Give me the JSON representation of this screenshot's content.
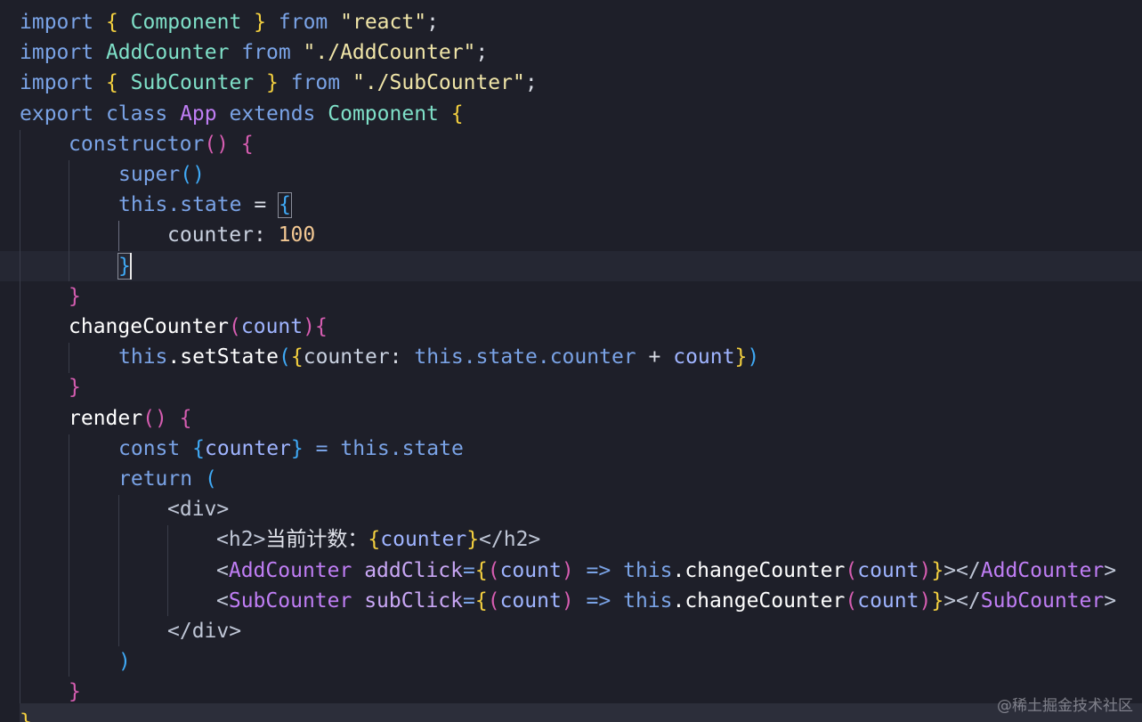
{
  "watermark": "@稀土掘金技术社区",
  "code": {
    "l1": {
      "kw": "import",
      "b1o": "{",
      "cls": "Component",
      "b1c": "}",
      "kw2": "from",
      "str": "\"react\"",
      "semi": ";"
    },
    "l2": {
      "kw": "import",
      "cls": "AddCounter",
      "kw2": "from",
      "str": "\"./AddCounter\"",
      "semi": ";"
    },
    "l3": {
      "kw": "import",
      "b1o": "{",
      "cls": "SubCounter",
      "b1c": "}",
      "kw2": "from",
      "str": "\"./SubCounter\"",
      "semi": ";"
    },
    "l4": {
      "kw": "export",
      "kw2": "class",
      "name": "App",
      "kw3": "extends",
      "cls": "Component",
      "b1o": "{"
    },
    "l5": {
      "fn": "constructor",
      "paren": "()",
      "b2o": "{"
    },
    "l6": {
      "fn": "super",
      "paren": "()"
    },
    "l7": {
      "this": "this",
      "prop": ".state",
      "op": "=",
      "b3o": "{"
    },
    "l8": {
      "prop": "counter",
      "colon": ":",
      "num": "100"
    },
    "l9": {
      "b3c": "}"
    },
    "l10": {
      "b2c": "}"
    },
    "l11": {
      "fn": "changeCounter",
      "po": "(",
      "arg": "count",
      "pc": ")",
      "b2o": "{"
    },
    "l12": {
      "this": "this",
      "fn": ".setState",
      "po": "(",
      "bo": "{",
      "p1": "counter",
      "colon": ":",
      "this2": "this",
      "p2": ".state.counter",
      "op": "+",
      "arg": "count",
      "bc": "}",
      "pc": ")"
    },
    "l13": {
      "b2c": "}"
    },
    "l14": {
      "fn": "render",
      "paren": "()",
      "b2o": "{"
    },
    "l15": {
      "kw": "const",
      "bo": "{",
      "v": "counter",
      "bc": "}",
      "op": "=",
      "this": "this",
      "p": ".state"
    },
    "l16": {
      "kw": "return",
      "po": "("
    },
    "l17": {
      "tag": "<div>"
    },
    "l18": {
      "to": "<h2>",
      "txt": "当前计数：",
      "bo": "{",
      "v": "counter",
      "bc": "}",
      "tc": "</h2>"
    },
    "l19": {
      "lt": "<",
      "comp": "AddCounter",
      "attr": "addClick",
      "eq": "=",
      "bo": "{",
      "po": "(",
      "arg": "count",
      "pc": ")",
      "arrow": "=>",
      "this": "this",
      "fn": ".changeCounter",
      "po2": "(",
      "arg2": "count",
      "pc2": ")",
      "bc": "}",
      "gt": ">",
      "clo": "</",
      "comp2": "AddCounter",
      "gt2": ">"
    },
    "l20": {
      "lt": "<",
      "comp": "SubCounter",
      "attr": "subClick",
      "eq": "=",
      "bo": "{",
      "po": "(",
      "arg": "count",
      "pc": ")",
      "arrow": "=>",
      "this": "this",
      "fn": ".changeCounter",
      "po2": "(",
      "arg2": "count",
      "pc2": ")",
      "bc": "}",
      "gt": ">",
      "clo": "</",
      "comp2": "SubCounter",
      "gt2": ">"
    },
    "l21": {
      "tag": "</div>"
    },
    "l22": {
      "pc": ")"
    },
    "l23": {
      "b2c": "}"
    },
    "l24": {
      "b1c": "}"
    }
  }
}
